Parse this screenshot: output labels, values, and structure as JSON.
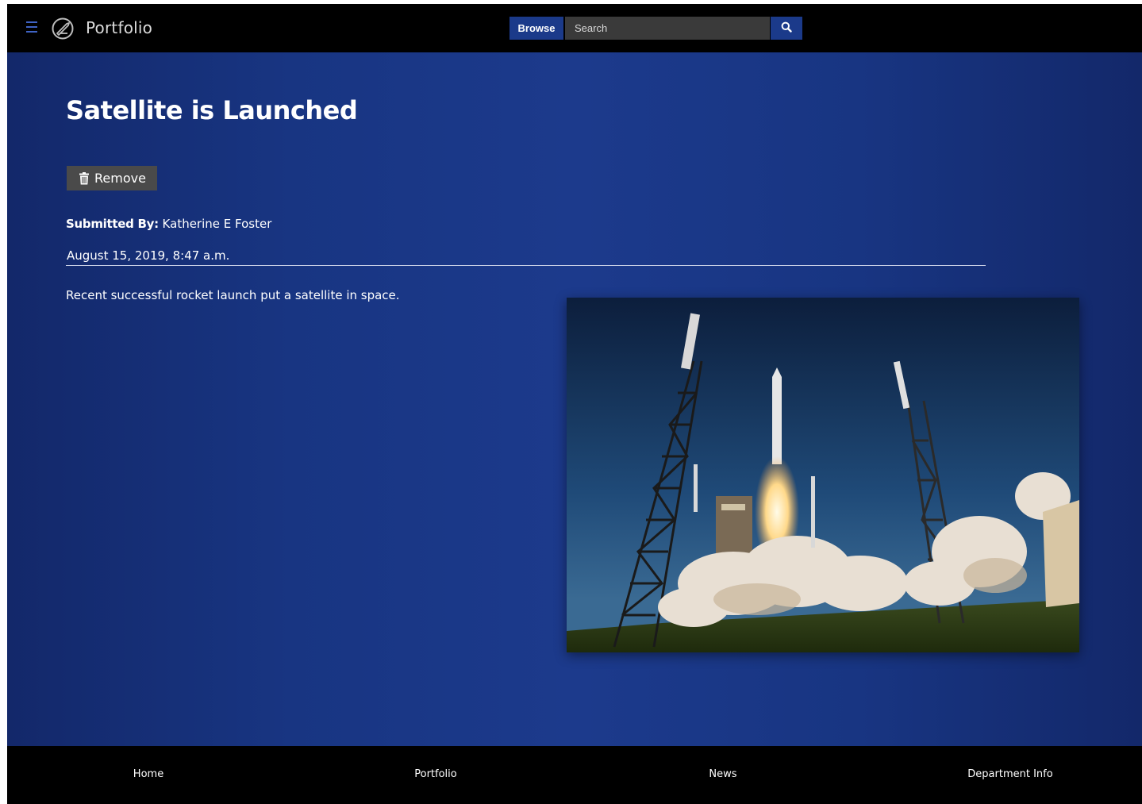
{
  "header": {
    "brand": "Portfolio",
    "browse_label": "Browse",
    "search_placeholder": "Search"
  },
  "post": {
    "title": "Satellite is Launched",
    "remove_label": "Remove",
    "submitted_by_label": "Submitted By:",
    "submitted_by_name": " Katherine E Foster",
    "date": "August 15, 2019, 8:47 a.m.",
    "description": "Recent successful rocket launch put a satellite in space."
  },
  "footer": {
    "links": [
      {
        "label": "Home"
      },
      {
        "label": "Portfolio"
      },
      {
        "label": "News"
      },
      {
        "label": "Department Info"
      }
    ]
  },
  "colors": {
    "accent": "#1b3a8a",
    "menu_icon": "#3f63c4",
    "background_gradient": [
      "#13286a",
      "#1c3a8c"
    ]
  },
  "icons": {
    "menu": "hamburger-menu-icon",
    "logo": "pen-circle-logo-icon",
    "search": "search-icon",
    "remove": "trash-icon"
  }
}
